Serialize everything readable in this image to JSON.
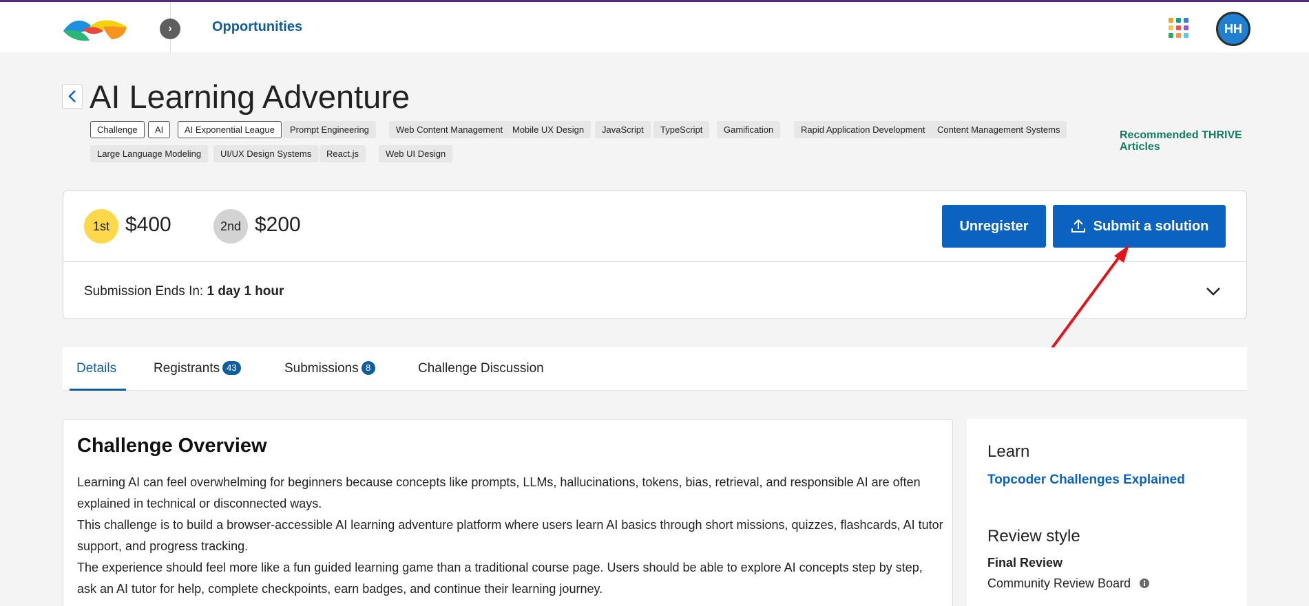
{
  "header": {
    "nav_title": "Opportunities",
    "nav_toggle_glyph": "›",
    "avatar_initials": "HH",
    "apps_colors": [
      "#f7a21b",
      "#16a085",
      "#2f80ed",
      "#f2c94c",
      "#eb5757",
      "#9b51e0",
      "#27ae60",
      "#f2994a",
      "#56ccf2"
    ]
  },
  "page": {
    "title": "AI Learning Adventure",
    "tags": [
      {
        "label": "Challenge",
        "outlined": true
      },
      {
        "label": "AI",
        "outlined": true
      },
      {
        "label": "AI Exponential League",
        "outlined": true
      },
      {
        "label": "Prompt Engineering",
        "outlined": false
      },
      {
        "label": "Web Content Management",
        "outlined": false
      },
      {
        "label": "Mobile UX Design",
        "outlined": false
      },
      {
        "label": "JavaScript",
        "outlined": false
      },
      {
        "label": "TypeScript",
        "outlined": false
      },
      {
        "label": "Gamification",
        "outlined": false
      },
      {
        "label": "Rapid Application Development",
        "outlined": false
      },
      {
        "label": "Content Management Systems",
        "outlined": false
      },
      {
        "label": "Large Language Modeling",
        "outlined": false
      },
      {
        "label": "UI/UX Design Systems",
        "outlined": false
      },
      {
        "label": "React.js",
        "outlined": false
      },
      {
        "label": "Web UI Design",
        "outlined": false
      }
    ],
    "recommended_link": "Recommended THRIVE Articles"
  },
  "prizes": [
    {
      "place": "1st",
      "amount": "$400",
      "color": "#fcd84a"
    },
    {
      "place": "2nd",
      "amount": "$200",
      "color": "#d3d3d3"
    }
  ],
  "actions": {
    "unregister_label": "Unregister",
    "submit_label": "Submit a solution"
  },
  "deadline": {
    "label": "Submission Ends In:",
    "value": "1 day 1 hour"
  },
  "tabs": [
    {
      "label": "Details",
      "count": null,
      "active": true
    },
    {
      "label": "Registrants",
      "count": "43",
      "active": false
    },
    {
      "label": "Submissions",
      "count": "8",
      "active": false
    },
    {
      "label": "Challenge Discussion",
      "count": null,
      "active": false
    }
  ],
  "overview": {
    "title": "Challenge Overview",
    "paragraphs": [
      "Learning AI can feel overwhelming for beginners because concepts like prompts, LLMs, hallucinations, tokens, bias, retrieval, and responsible AI are often explained in technical or disconnected ways.",
      "This challenge is to build a browser-accessible AI learning adventure platform where users learn AI basics through short missions, quizzes, flashcards, AI tutor support, and progress tracking.",
      "The experience should feel more like a fun guided learning game than a traditional course page. Users should be able to explore AI concepts step by step, ask an AI tutor for help, complete checkpoints, earn badges, and continue their learning journey."
    ]
  },
  "sidebar": {
    "learn_heading": "Learn",
    "learn_link": "Topcoder Challenges Explained",
    "review_heading": "Review style",
    "review_type": "Final Review",
    "review_board": "Community Review Board"
  },
  "annotation_color": "#e0151b"
}
